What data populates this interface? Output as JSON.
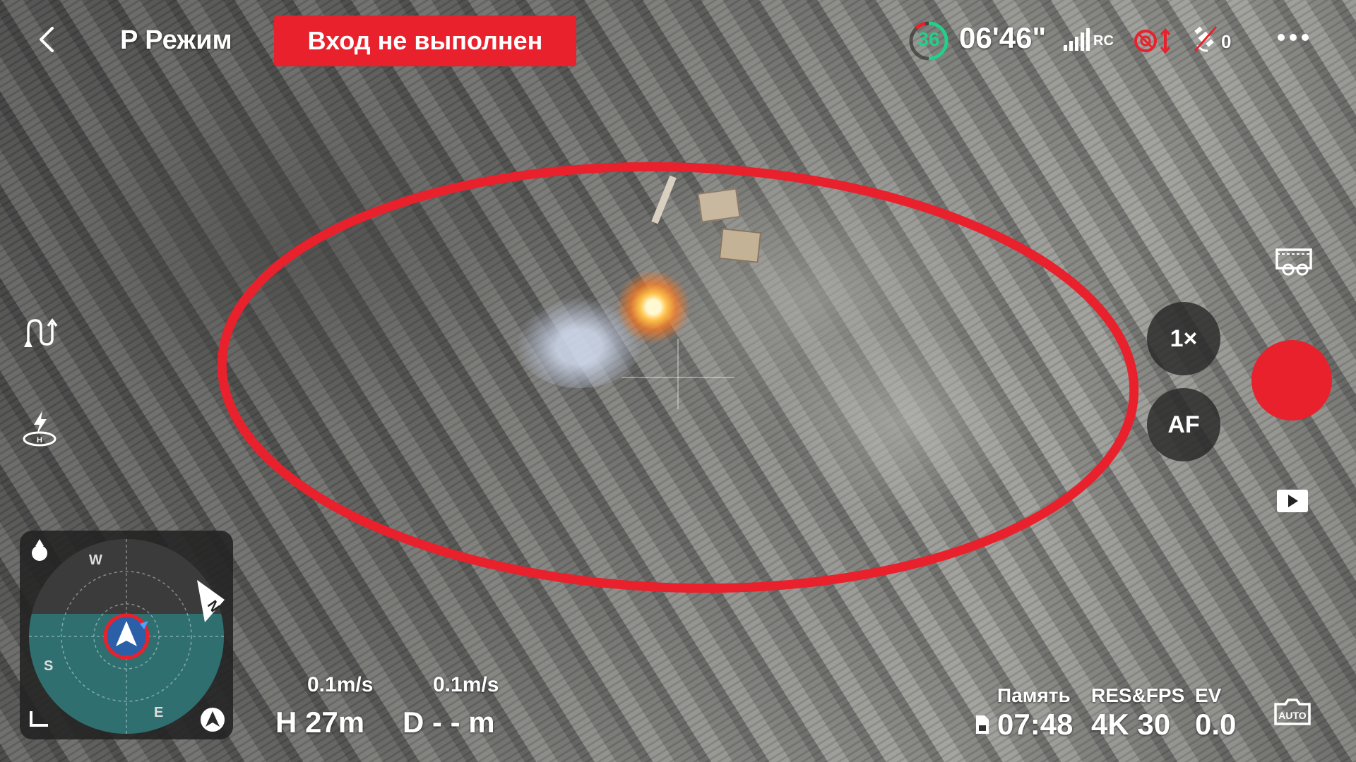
{
  "top_bar": {
    "back_icon": "chevron-left-icon",
    "mode_label": "P Режим",
    "status_text": "Вход не выполнен",
    "status_color": "#e8212d",
    "battery_percent": "36",
    "battery_color": "#22d08a",
    "flight_time": "06'46\"",
    "rc_label": "RC",
    "gps_count": "0",
    "more_icon": "more-horizontal-icon"
  },
  "left_tools": {
    "route_icon": "route-icon",
    "takeoff_icon": "takeoff-landing-icon"
  },
  "minimap": {
    "north": "N",
    "west": "W",
    "south": "S",
    "east": "E"
  },
  "telemetry": {
    "horizontal_speed": "0.1m/s",
    "vertical_speed": "0.1m/s",
    "height": "H 27m",
    "distance": "D - - m"
  },
  "camera_info": {
    "memory_label": "Память",
    "memory_value": "07:48",
    "res_label": "RES&FPS",
    "res_value": "4K 30",
    "ev_label": "EV",
    "ev_value": "0.0"
  },
  "right_controls": {
    "media_icon": "media-library-icon",
    "zoom_label": "1×",
    "af_label": "AF",
    "shutter_color": "#e8212d",
    "play_icon": "playback-icon",
    "auto_icon": "auto-mode-icon"
  },
  "overlay": {
    "target_ring_color": "#e8212d"
  }
}
